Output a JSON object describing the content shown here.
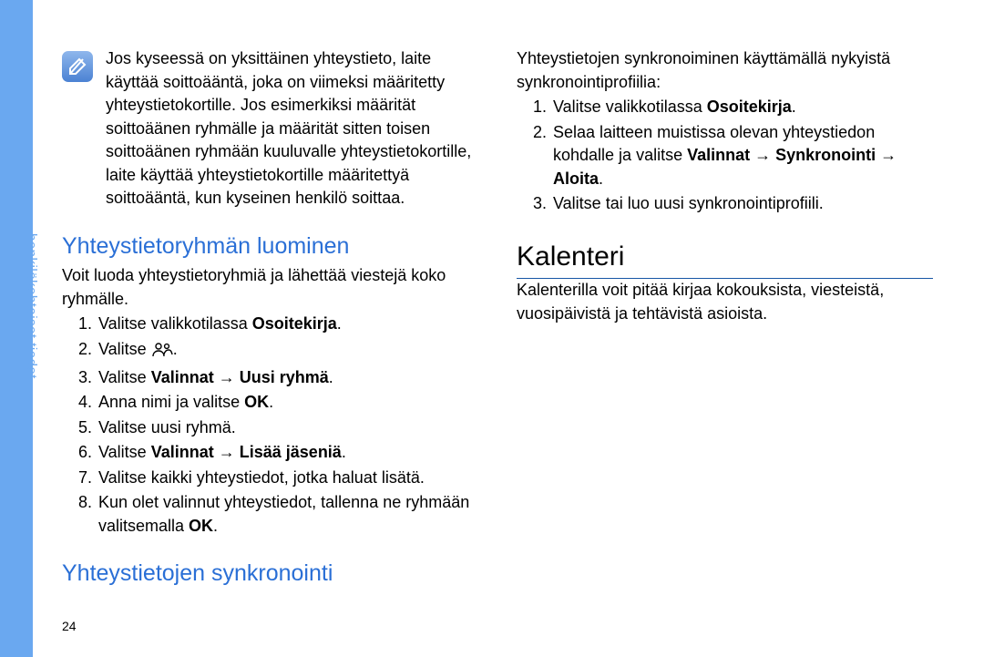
{
  "side_tab": "henkilökohtaiset tiedot",
  "page_number": "24",
  "note": {
    "text": "Jos kyseessä on yksittäinen yhteystieto, laite käyttää soittoääntä, joka on viimeksi määritetty yhteystietokortille. Jos esimerkiksi määrität soittoäänen ryhmälle ja määrität sitten toisen soittoäänen ryhmään kuuluvalle yhteystietokortille, laite käyttää yhteystietokortille määritettyä soittoääntä, kun kyseinen henkilö soittaa."
  },
  "section_group": {
    "heading": "Yhteystietoryhmän luominen",
    "intro": "Voit luoda yhteystietoryhmiä ja lähettää viestejä koko ryhmälle.",
    "step1_pre": "Valitse valikkotilassa ",
    "step1_b": "Osoitekirja",
    "step2_pre": "Valitse ",
    "step3_pre": "Valitse ",
    "step3_b1": "Valinnat",
    "step3_b2": "Uusi ryhmä",
    "step4_pre": "Anna nimi ja valitse ",
    "step4_b": "OK",
    "step5": "Valitse uusi ryhmä.",
    "step6_pre": "Valitse ",
    "step6_b1": "Valinnat",
    "step6_b2": "Lisää jäseniä",
    "step7": "Valitse kaikki yhteystiedot, jotka haluat lisätä.",
    "step8_pre": "Kun olet valinnut yhteystiedot, tallenna ne ryhmään valitsemalla ",
    "step8_b": "OK"
  },
  "section_sync": {
    "heading": "Yhteystietojen synkronointi",
    "intro": "Yhteystietojen synkronoiminen käyttämällä nykyistä synkronointiprofiilia:",
    "step1_pre": "Valitse valikkotilassa ",
    "step1_b": "Osoitekirja",
    "step2_pre": "Selaa laitteen muistissa olevan yhteystiedon kohdalle ja valitse ",
    "step2_b1": "Valinnat",
    "step2_b2": "Synkronointi",
    "step2_b3": "Aloita",
    "step3": "Valitse tai luo uusi synkronointiprofiili."
  },
  "section_calendar": {
    "title": "Kalenteri",
    "intro": "Kalenterilla voit pitää kirjaa kokouksista, viesteistä, vuosipäivistä ja tehtävistä asioista."
  }
}
